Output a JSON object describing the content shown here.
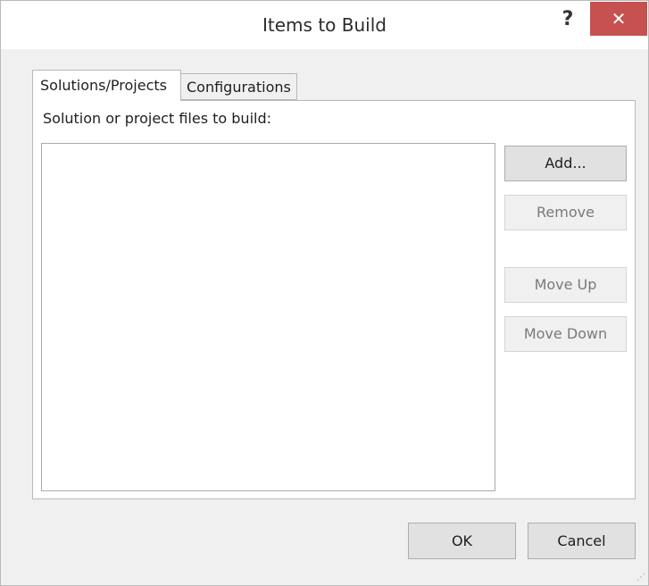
{
  "window": {
    "title": "Items to Build",
    "help_glyph": "?",
    "close_glyph": "✕"
  },
  "tabs": [
    {
      "label": "Solutions/Projects",
      "selected": true
    },
    {
      "label": "Configurations",
      "selected": false
    }
  ],
  "panel": {
    "label": "Solution or project files to build:",
    "files": []
  },
  "side_buttons": {
    "add": "Add...",
    "remove": "Remove",
    "move_up": "Move Up",
    "move_down": "Move Down"
  },
  "footer": {
    "ok": "OK",
    "cancel": "Cancel"
  },
  "colors": {
    "close_button": "#c75050",
    "dialog_background": "#f0f0f0"
  }
}
